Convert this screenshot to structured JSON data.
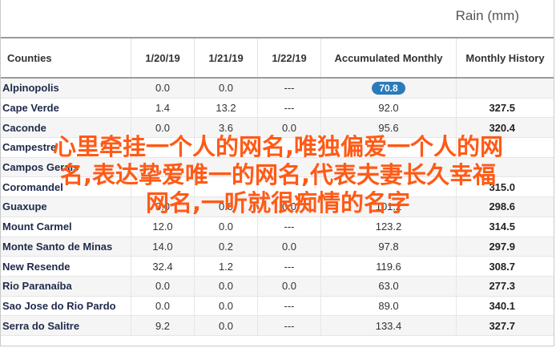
{
  "unit_label": "Rain (mm)",
  "columns": [
    "Counties",
    "1/20/19",
    "1/21/19",
    "1/22/19",
    "Accumulated Monthly",
    "Monthly History"
  ],
  "rows": [
    {
      "name": "Alpinopolis",
      "d1": "0.0",
      "d2": "0.0",
      "d3": "---",
      "acc": "70.8",
      "mon": ""
    },
    {
      "name": "Cape Verde",
      "d1": "1.4",
      "d2": "13.2",
      "d3": "---",
      "acc": "92.0",
      "mon": "327.5"
    },
    {
      "name": "Caconde",
      "d1": "0.0",
      "d2": "3.6",
      "d3": "0.0",
      "acc": "95.6",
      "mon": "320.4"
    },
    {
      "name": "Campestre",
      "d1": "",
      "d2": "",
      "d3": "",
      "acc": "",
      "mon": ""
    },
    {
      "name": "Campos Gerais",
      "d1": "",
      "d2": "",
      "d3": "",
      "acc": "",
      "mon": ""
    },
    {
      "name": "Coromandel",
      "d1": "",
      "d2": "",
      "d3": "",
      "acc": "",
      "mon": "315.0"
    },
    {
      "name": "Guaxupe",
      "d1": "0.0",
      "d2": "0.0",
      "d3": "0.0",
      "acc": "101.2",
      "mon": "298.6"
    },
    {
      "name": "Mount Carmel",
      "d1": "12.0",
      "d2": "0.0",
      "d3": "---",
      "acc": "123.2",
      "mon": "314.5"
    },
    {
      "name": "Monte Santo de Minas",
      "d1": "14.0",
      "d2": "0.2",
      "d3": "0.0",
      "acc": "97.8",
      "mon": "297.9"
    },
    {
      "name": "New Resende",
      "d1": "32.4",
      "d2": "1.2",
      "d3": "---",
      "acc": "119.6",
      "mon": "308.7"
    },
    {
      "name": "Rio Paranaíba",
      "d1": "0.0",
      "d2": "0.0",
      "d3": "0.0",
      "acc": "63.0",
      "mon": "277.3"
    },
    {
      "name": "Sao Jose do Rio Pardo",
      "d1": "0.0",
      "d2": "0.0",
      "d3": "---",
      "acc": "89.0",
      "mon": "340.1"
    },
    {
      "name": "Serra do Salitre",
      "d1": "9.2",
      "d2": "0.0",
      "d3": "---",
      "acc": "133.4",
      "mon": "327.7"
    }
  ],
  "overlay_lines": [
    "心里牵挂一个人的网名,唯独偏爱一个人的网",
    "名,表达挚爱唯一的网名,代表夫妻长久幸福",
    "网名,一听就很痴情的名字"
  ],
  "colors": {
    "pill": "#2b7bb9",
    "overlay": "#ff5a16",
    "county": "#1e2a4a"
  }
}
